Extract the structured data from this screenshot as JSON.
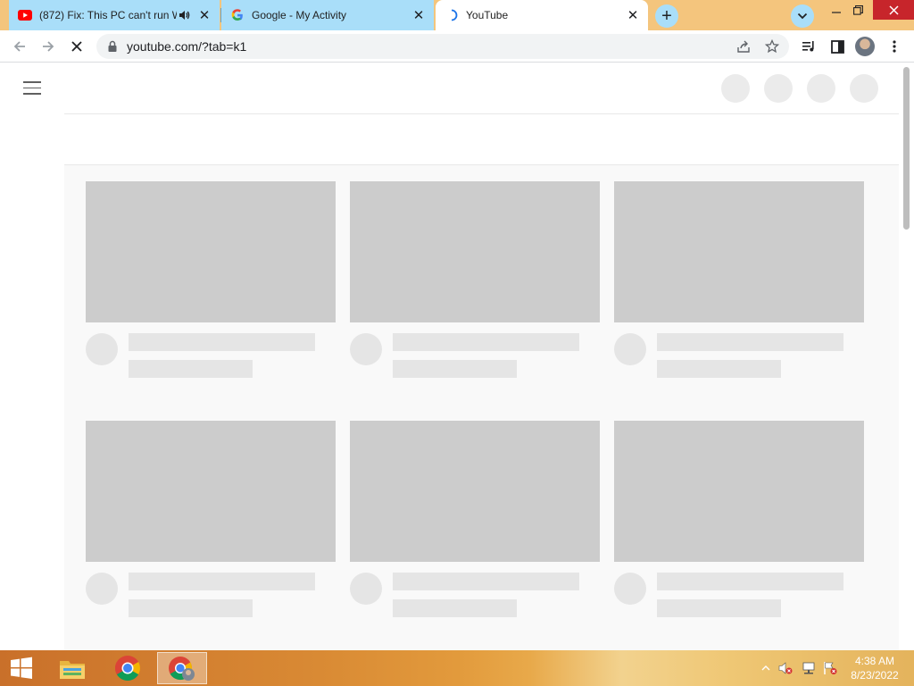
{
  "browser": {
    "tabs": [
      {
        "title": "(872) Fix: This PC can't run W",
        "favicon": "youtube-icon",
        "audio": "speaker-icon"
      },
      {
        "title": "Google - My Activity",
        "favicon": "google-icon"
      },
      {
        "title": "YouTube",
        "favicon": "loading-spinner-icon",
        "active": true
      }
    ],
    "url": "youtube.com/?tab=k1",
    "colors": {
      "frame": "#f4c57d",
      "inactive_tab": "#a9def9",
      "youtube_red": "#ff0000"
    }
  },
  "page": {
    "state": "loading-skeleton",
    "header_placeholders": 4,
    "rows": 2,
    "columns": 3
  },
  "taskbar": {
    "apps": [
      "file-explorer-icon",
      "chrome-icon",
      "chrome-profile-icon"
    ],
    "time": "4:38 AM",
    "date": "8/23/2022"
  }
}
